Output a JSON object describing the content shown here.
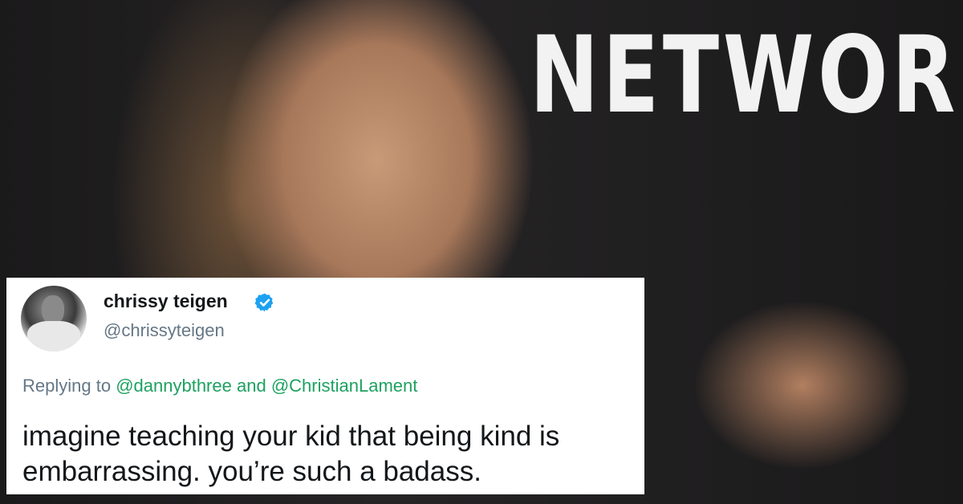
{
  "background": {
    "signage_text": "NETWORK"
  },
  "tweet": {
    "display_name": "chrissy teigen",
    "handle": "@chrissyteigen",
    "verified_icon": "verified-badge-icon",
    "reply_prefix": "Replying to",
    "reply_user_1": "@dannybthree",
    "reply_and": "and",
    "reply_user_2": "@ChristianLament",
    "body_line_1": "imagine teaching your kid that being kind is",
    "body_line_2": "embarrassing. you’re such a badass.",
    "colors": {
      "mention": "#1da160",
      "verified": "#1da1f2",
      "secondary_text": "#657786"
    }
  }
}
